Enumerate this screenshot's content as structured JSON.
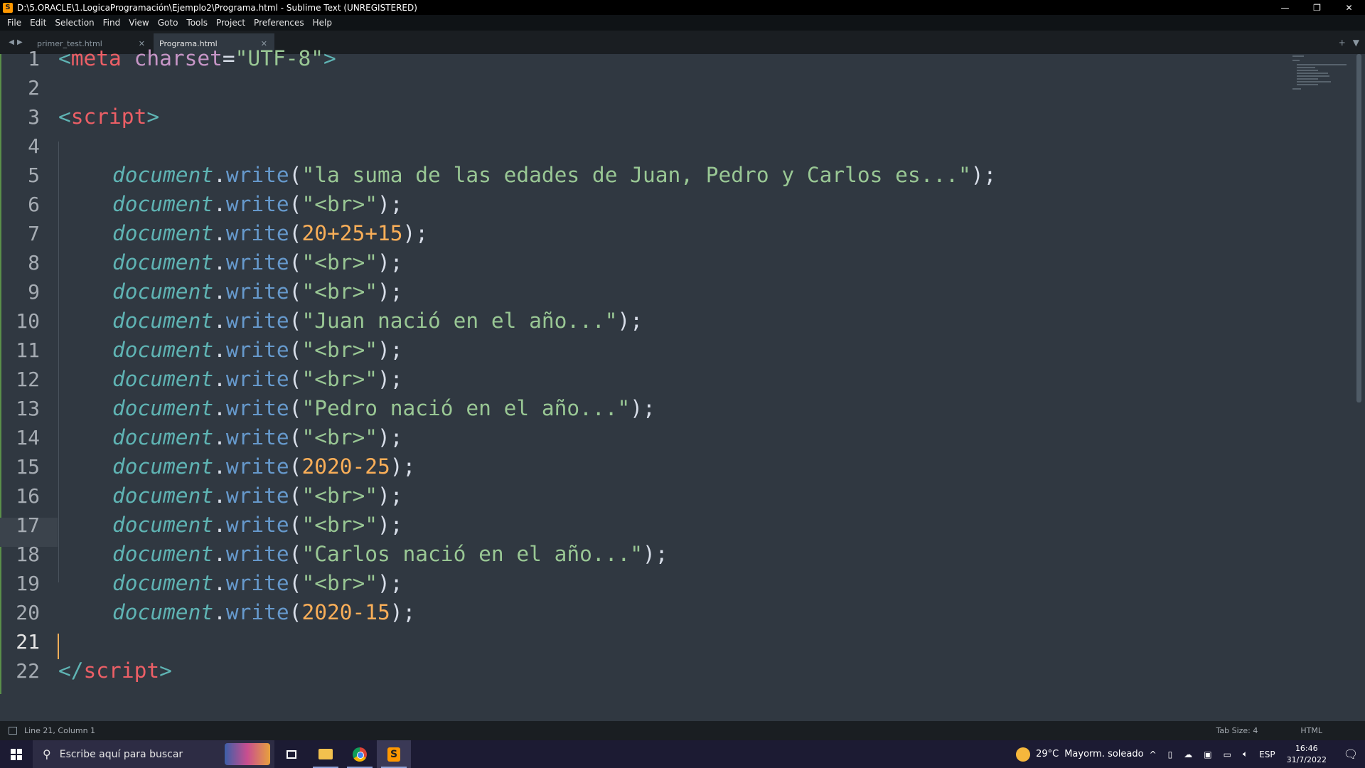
{
  "window": {
    "title": "D:\\5.ORACLE\\1.LogicaProgramación\\Ejemplo2\\Programa.html - Sublime Text (UNREGISTERED)",
    "minimize": "—",
    "maximize": "❐",
    "close": "✕"
  },
  "menu": [
    "File",
    "Edit",
    "Selection",
    "Find",
    "View",
    "Goto",
    "Tools",
    "Project",
    "Preferences",
    "Help"
  ],
  "tabs": [
    {
      "label": "primer_test.html",
      "active": false
    },
    {
      "label": "Programa.html",
      "active": true
    }
  ],
  "editor": {
    "current_line": 21,
    "lines": [
      "1",
      "2",
      "3",
      "4",
      "5",
      "6",
      "7",
      "8",
      "9",
      "10",
      "11",
      "12",
      "13",
      "14",
      "15",
      "16",
      "17",
      "18",
      "19",
      "20",
      "21",
      "22"
    ],
    "code": {
      "l1": {
        "open": "<",
        "tag": "meta",
        "attr": "charset",
        "eq": "=",
        "val": "\"UTF-8\"",
        "close": ">"
      },
      "l3": {
        "open": "<",
        "tag": "script",
        "close": ">"
      },
      "obj": "document",
      "dot": ".",
      "fn": "write",
      "l5": "\"la suma de las edades de Juan, Pedro y Carlos es...\"",
      "br": "\"<br>\"",
      "l7": "20+25+15",
      "l10": "\"Juan nació en el año...\"",
      "l13": "\"Pedro nació en el año...\"",
      "l15": "2020-25",
      "l18": "\"Carlos nació en el año...\"",
      "l20": "2020-15",
      "l22": {
        "open": "</",
        "tag": "script",
        "close": ">"
      },
      "paren_open": "(",
      "paren_close": ");"
    }
  },
  "status": {
    "position": "Line 21, Column 1",
    "tab_size": "Tab Size: 4",
    "syntax": "HTML"
  },
  "taskbar": {
    "search_placeholder": "Escribe aquí para buscar",
    "temperature": "29°C",
    "weather": "Mayorm. soleado",
    "language": "ESP",
    "time": "16:46",
    "date": "31/7/2022"
  },
  "colors": {
    "editor_bg": "#303841",
    "tag": "#5fb4b4",
    "tag_name": "#ec5f66",
    "attribute": "#c695c6",
    "string": "#99c794",
    "function": "#6699cc",
    "number": "#f9ae58"
  }
}
